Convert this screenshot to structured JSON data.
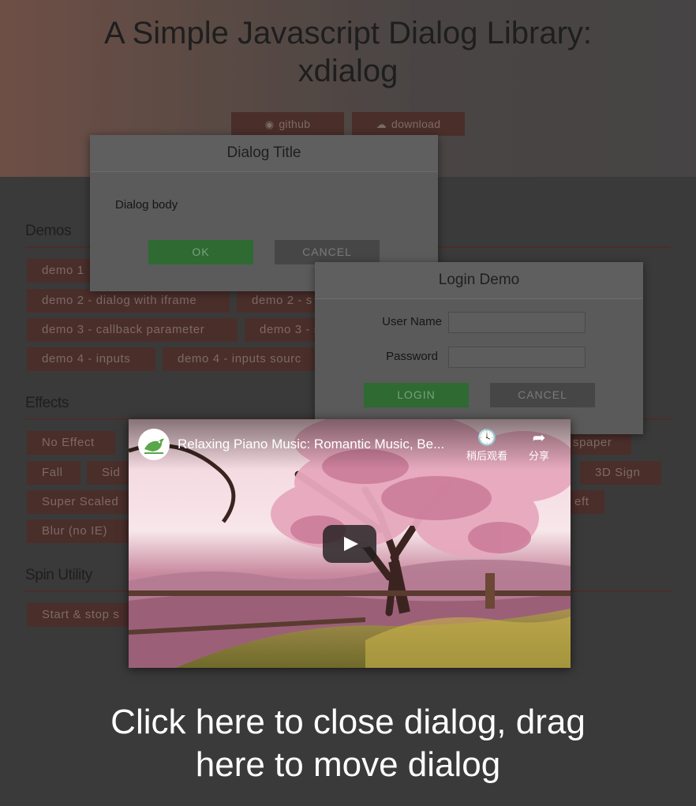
{
  "hero": {
    "title_line1": "A Simple Javascript Dialog Library:",
    "title_line2": "xdialog",
    "buttons": [
      {
        "label": "github",
        "icon": "github-icon"
      },
      {
        "label": "download",
        "icon": "cloud-download-icon"
      }
    ]
  },
  "sections": {
    "demos": {
      "title": "Demos",
      "items": [
        "demo 1",
        "demo 2 - dialog with iframe",
        "demo 2 - s",
        "demo 3 - callback parameter",
        "demo 3 - s",
        "demo 4 - inputs",
        "demo 4 - inputs sourc"
      ]
    },
    "effects": {
      "title": "Effects",
      "items": [
        "No Effect",
        "spaper",
        "Fall",
        "Sid",
        "3D Sign",
        "Super Scaled",
        "eft",
        "Blur (no IE)"
      ]
    },
    "spin": {
      "title": "Spin Utility",
      "items": [
        "Start & stop s"
      ]
    }
  },
  "dialog_basic": {
    "title": "Dialog Title",
    "body": "Dialog body",
    "ok_label": "OK",
    "cancel_label": "CANCEL"
  },
  "dialog_login": {
    "title": "Login Demo",
    "username_label": "User Name",
    "password_label": "Password",
    "username_value": "",
    "password_value": "",
    "login_label": "LOGIN",
    "cancel_label": "CANCEL"
  },
  "video": {
    "title": "Relaxing Piano Music: Romantic Music, Be...",
    "watch_later_label": "稍后观看",
    "share_label": "分享"
  },
  "overlay": {
    "line1": "Click here to close dialog, drag",
    "line2": "here to move dialog"
  },
  "colors": {
    "ok_button": "#2e6a32",
    "cancel_button": "#464646",
    "chip_bg": "#4a2e2a",
    "overlay_bg": "#3a3a3a"
  }
}
